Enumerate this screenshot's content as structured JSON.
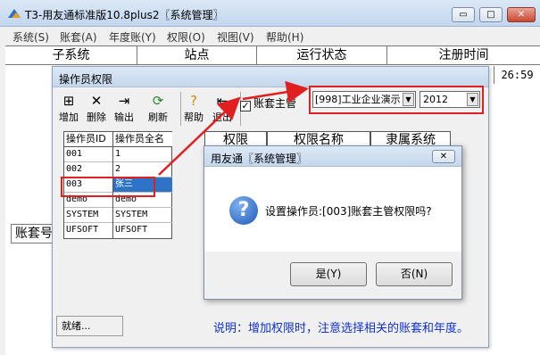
{
  "window": {
    "title": "T3-用友通标准版10.8plus2〖系统管理〗",
    "controls": {
      "minimize": "▭",
      "maximize": "□",
      "close": "✕"
    }
  },
  "menu": [
    "系统(S)",
    "账套(A)",
    "年度账(Y)",
    "权限(O)",
    "视图(V)",
    "帮助(H)"
  ],
  "main_grid": {
    "headers": [
      "子系统",
      "站点",
      "运行状态",
      "注册时间"
    ],
    "time_value": "26:59",
    "account_label": "账套号"
  },
  "perm_window": {
    "title": "操作员权限",
    "toolbar": [
      {
        "label": "增加",
        "icon": "add-icon"
      },
      {
        "label": "删除",
        "icon": "delete-icon"
      },
      {
        "label": "输出",
        "icon": "export-icon"
      },
      {
        "label": "刷新",
        "icon": "refresh-icon"
      },
      {
        "label": "帮助",
        "icon": "help-icon"
      },
      {
        "label": "退出",
        "icon": "exit-icon"
      }
    ],
    "master_checkbox": {
      "label": "账套主管",
      "checked": true
    },
    "account_select": "[998]工业企业演示",
    "year_select": "2012",
    "operator_table": {
      "headers": [
        "操作员ID",
        "操作员全名"
      ],
      "rows": [
        [
          "001",
          "1"
        ],
        [
          "002",
          "2"
        ],
        [
          "003",
          "张三"
        ],
        [
          "demo",
          "demo"
        ],
        [
          "SYSTEM",
          "SYSTEM"
        ],
        [
          "UFSOFT",
          "UFSOFT"
        ]
      ],
      "selected_index": 2
    },
    "right_headers": [
      "权限",
      "权限名称",
      "隶属系统"
    ],
    "status_ready": "就绪...",
    "status_note": "说明：增加权限时，注意选择相关的账套和年度。"
  },
  "dialog": {
    "title": "用友通〖系统管理〗",
    "close": "✕",
    "icon": "question-icon",
    "message": "设置操作员:[003]账套主管权限吗?",
    "yes": "是(Y)",
    "no": "否(N)"
  },
  "colors": {
    "highlight": "#e02020",
    "selection": "#2d74c9",
    "note": "#1030d0"
  }
}
